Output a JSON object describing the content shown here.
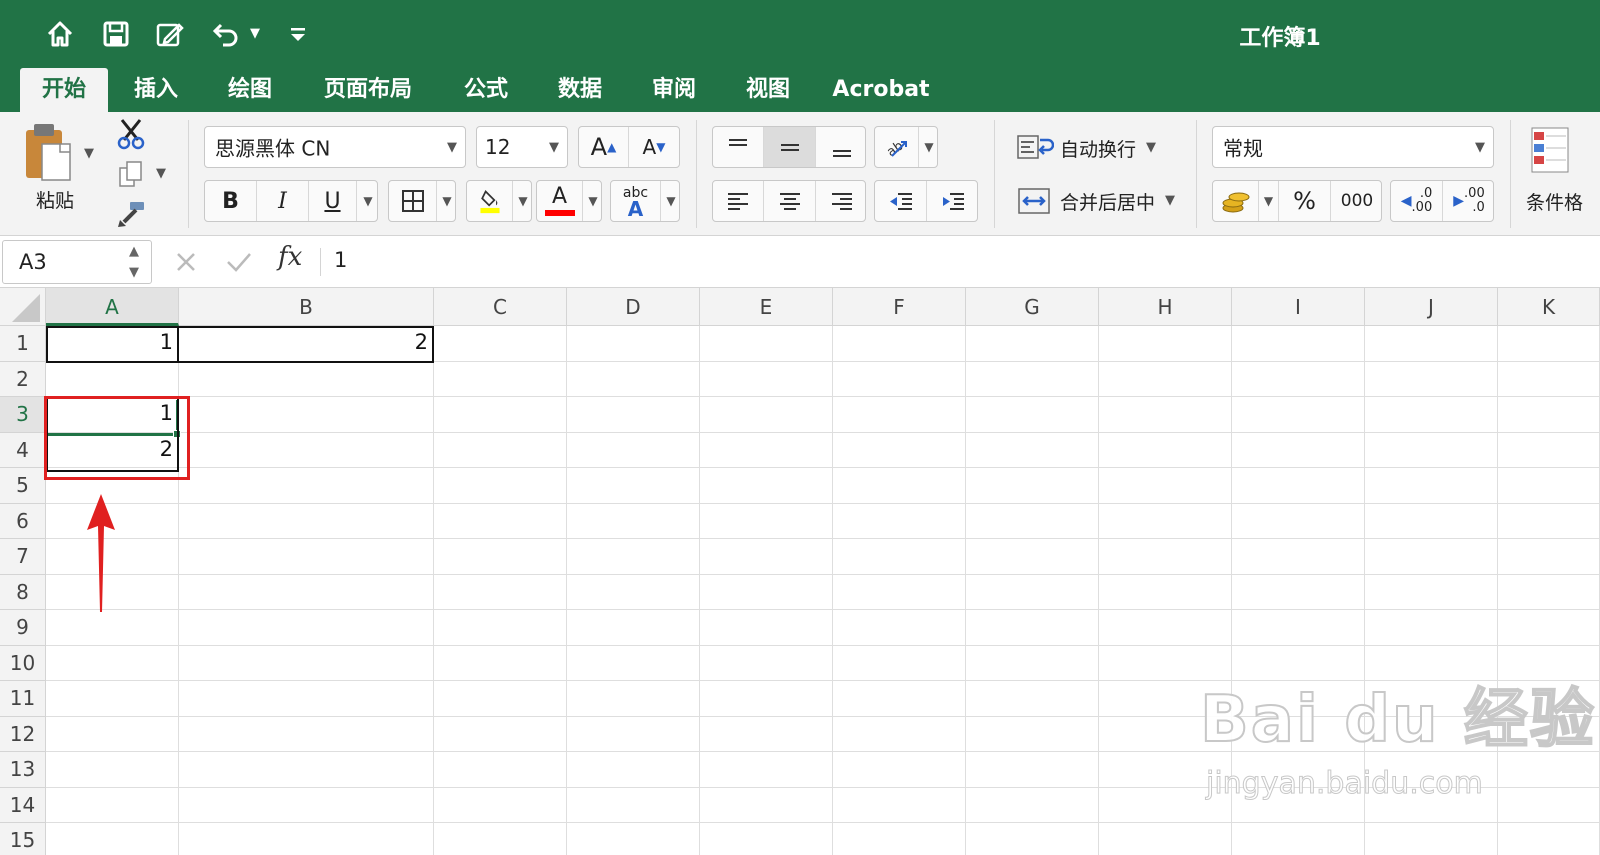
{
  "title_bar": {
    "document_title": "工作簿1",
    "quick_access": [
      "home-icon",
      "save-icon",
      "edit-icon",
      "undo-icon",
      "customize-icon"
    ]
  },
  "tabs": [
    "开始",
    "插入",
    "绘图",
    "页面布局",
    "公式",
    "数据",
    "审阅",
    "视图",
    "Acrobat"
  ],
  "active_tab": "开始",
  "ribbon": {
    "paste_label": "粘贴",
    "font_name": "思源黑体 CN",
    "font_size": "12",
    "bold": "B",
    "italic": "I",
    "underline": "U",
    "font_color_letter": "A",
    "phonetic_top": "abc",
    "phonetic_bottom": "A",
    "grow_font": "A",
    "shrink_font": "A",
    "wrap_text_label": "自动换行",
    "merge_center_label": "合并后居中",
    "number_format": "常规",
    "percent": "%",
    "thousands": "000",
    "inc_decimal_top": ".0",
    "inc_decimal_bottom": ".00",
    "dec_decimal_top": ".00",
    "dec_decimal_bottom": ".0",
    "conditional_format_label": "条件格",
    "fill_color": "#ffff00",
    "font_color": "#ff0000"
  },
  "formula_bar": {
    "name_box": "A3",
    "fx": "fx",
    "value": "1"
  },
  "grid": {
    "columns": [
      "A",
      "B",
      "C",
      "D",
      "E",
      "F",
      "G",
      "H",
      "I",
      "J",
      "K"
    ],
    "rows": [
      "1",
      "2",
      "3",
      "4",
      "5",
      "6",
      "7",
      "8",
      "9",
      "10",
      "11",
      "12",
      "13",
      "14",
      "15"
    ],
    "selected_cell": "A3",
    "cells": {
      "A1": "1",
      "B1": "2",
      "A3": "1",
      "A4": "2"
    }
  },
  "watermark": {
    "brand": "Bai du 经验",
    "url": "jingyan.baidu.com"
  },
  "colors": {
    "excel_green": "#217346",
    "annotation_red": "#e02020"
  }
}
